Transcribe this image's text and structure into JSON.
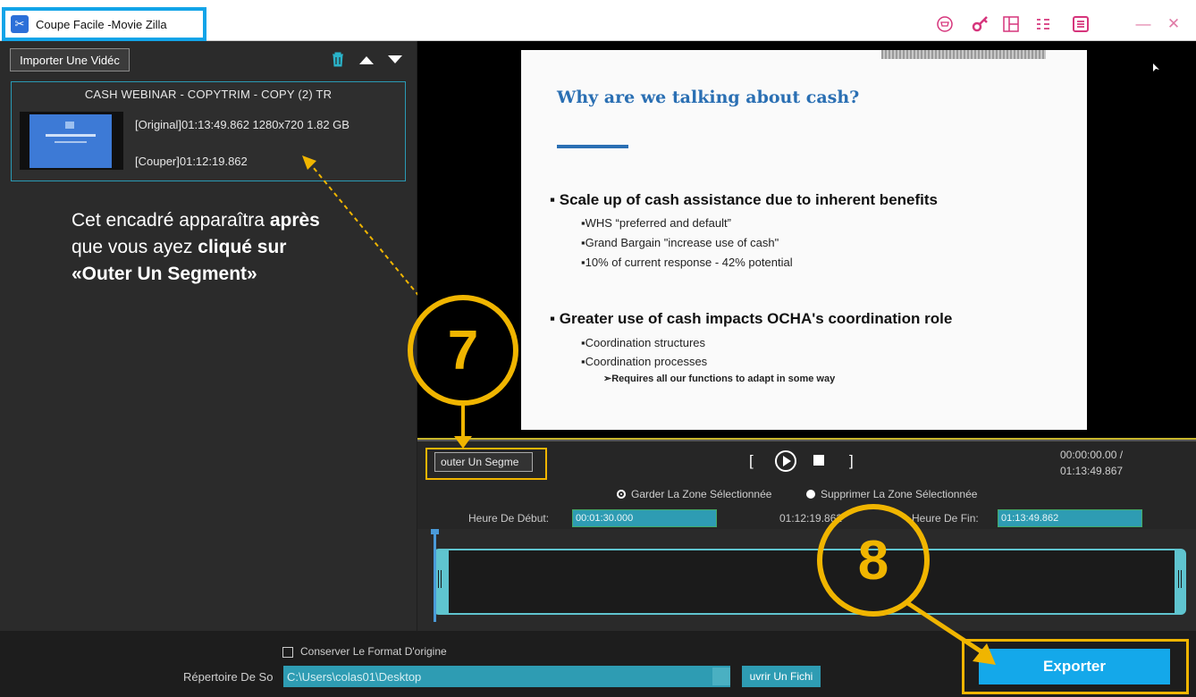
{
  "titlebar": {
    "title": "Coupe Facile -Movie Zilla",
    "icons": [
      "cart-icon",
      "key-icon",
      "layout-icon",
      "settings-sliders-icon",
      "menu-icon",
      "minimize-icon",
      "close-icon"
    ]
  },
  "left": {
    "import_label": "Importer Une Vidéc",
    "video": {
      "name": "CASH WEBINAR - COPYTRIM - COPY (2) TR",
      "original": "[Original]01:13:49.862 1280x720 1.82 GB",
      "couper": "[Couper]01:12:19.862"
    },
    "note_pre": "Cet encadré apparaîtra ",
    "note_bold1": "après",
    "note_mid": " que vous ayez ",
    "note_bold2": "cliqué sur «Outer Un Segment»"
  },
  "slide": {
    "title": "Why are we talking about cash?",
    "h1": "▪ Scale up of cash assistance due to inherent benefits",
    "s1": "▪WHS “preferred and default”",
    "s2": "▪Grand Bargain \"increase use of cash\"",
    "s3": "▪10% of current response - 42% potential",
    "h2": "▪ Greater use of cash impacts OCHA's coordination role",
    "s4": "▪Coordination structures",
    "s5": "▪Coordination processes",
    "s6": "➢Requires all our functions to adapt in some way"
  },
  "controls": {
    "segment_label": "outer Un Segme",
    "bracket_left": "[",
    "bracket_right": "]",
    "time_current": "00:00:00.00 /",
    "time_total": "01:13:49.867",
    "radio_keep": "Garder La Zone Sélectionnée",
    "radio_delete": "Supprimer La Zone Sélectionnée",
    "start_label": "Heure De Début:",
    "start_value": "00:01:30.000",
    "duration": "01:12:19.862",
    "end_label": "Heure De Fin:",
    "end_value": "01:13:49.862"
  },
  "bottom": {
    "keep_format": "Conserver Le Format D'origine",
    "dir_label": "Répertoire De So",
    "dir_value": "C:\\Users\\colas01\\Desktop",
    "open_file": "uvrir Un Fichi",
    "export": "Exporter"
  },
  "annotations": {
    "step7": "7",
    "step8": "8"
  },
  "colors": {
    "accent": "#14a8ea",
    "annotation": "#f0b500",
    "teal": "#2e9cb3"
  }
}
